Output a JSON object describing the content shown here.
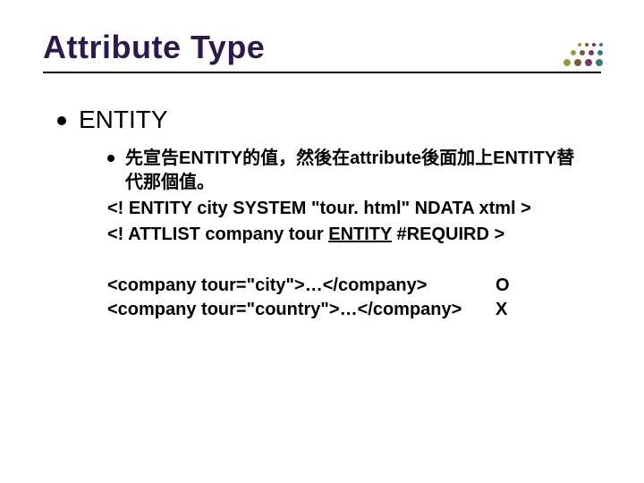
{
  "title": "Attribute Type",
  "level1": {
    "heading": "ENTITY"
  },
  "level2": {
    "desc": "先宣告ENTITY的值，然後在attribute後面加上ENTITY替代那個值。",
    "code1_pre": "<! ENTITY city SYSTEM \"tour. html\" NDATA xtml >",
    "code2_pre": "<! ATTLIST company tour ",
    "code2_u": "ENTITY",
    "code2_post": " #REQUIRD >"
  },
  "examples": {
    "ex1": {
      "code": "<company tour=\"city\">…</company>",
      "mark": "O"
    },
    "ex2": {
      "code": "<company tour=\"country\">…</company>",
      "mark": "X"
    }
  }
}
